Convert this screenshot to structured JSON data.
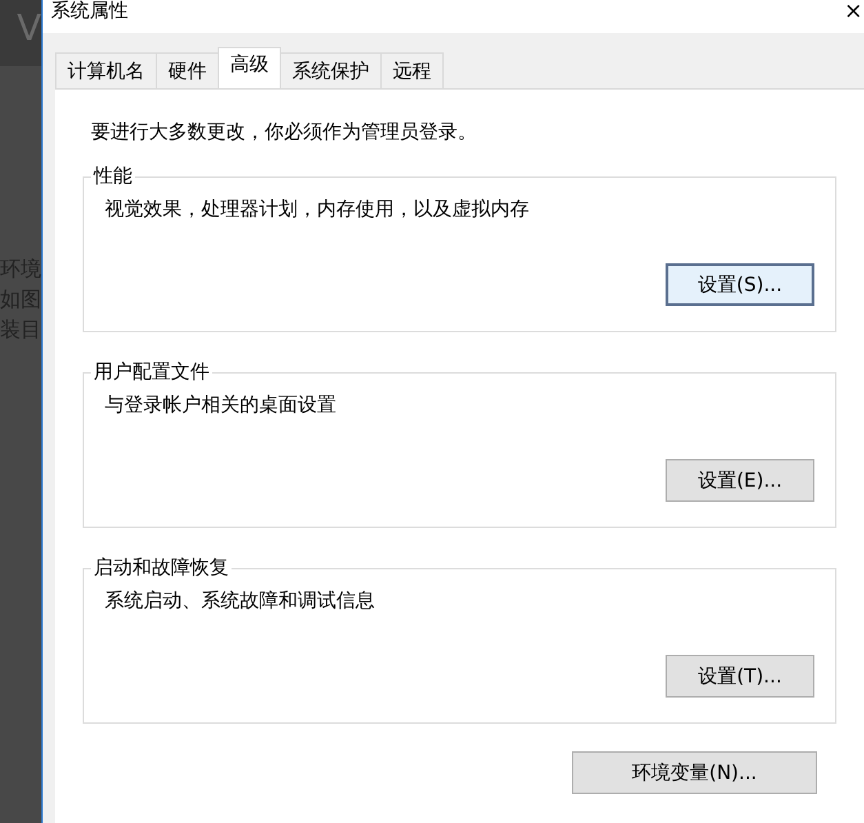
{
  "background_window": {
    "texts": [
      "V",
      "环境",
      "如图",
      "装目"
    ]
  },
  "window": {
    "title": "系统属性",
    "close": "×"
  },
  "tabs": [
    {
      "label": "计算机名",
      "selected": false
    },
    {
      "label": "硬件",
      "selected": false
    },
    {
      "label": "高级",
      "selected": true
    },
    {
      "label": "系统保护",
      "selected": false
    },
    {
      "label": "远程",
      "selected": false
    }
  ],
  "notice": "要进行大多数更改，你必须作为管理员登录。",
  "groups": [
    {
      "title": "性能",
      "description": "视觉效果，处理器计划，内存使用，以及虚拟内存",
      "button": {
        "label": "设置(S)...",
        "focused": true
      }
    },
    {
      "title": "用户配置文件",
      "description": "与登录帐户相关的桌面设置",
      "button": {
        "label": "设置(E)...",
        "focused": false
      }
    },
    {
      "title": "启动和故障恢复",
      "description": "系统启动、系统故障和调试信息",
      "button": {
        "label": "设置(T)...",
        "focused": false
      }
    }
  ],
  "env_button": {
    "label": "环境变量(N)..."
  }
}
